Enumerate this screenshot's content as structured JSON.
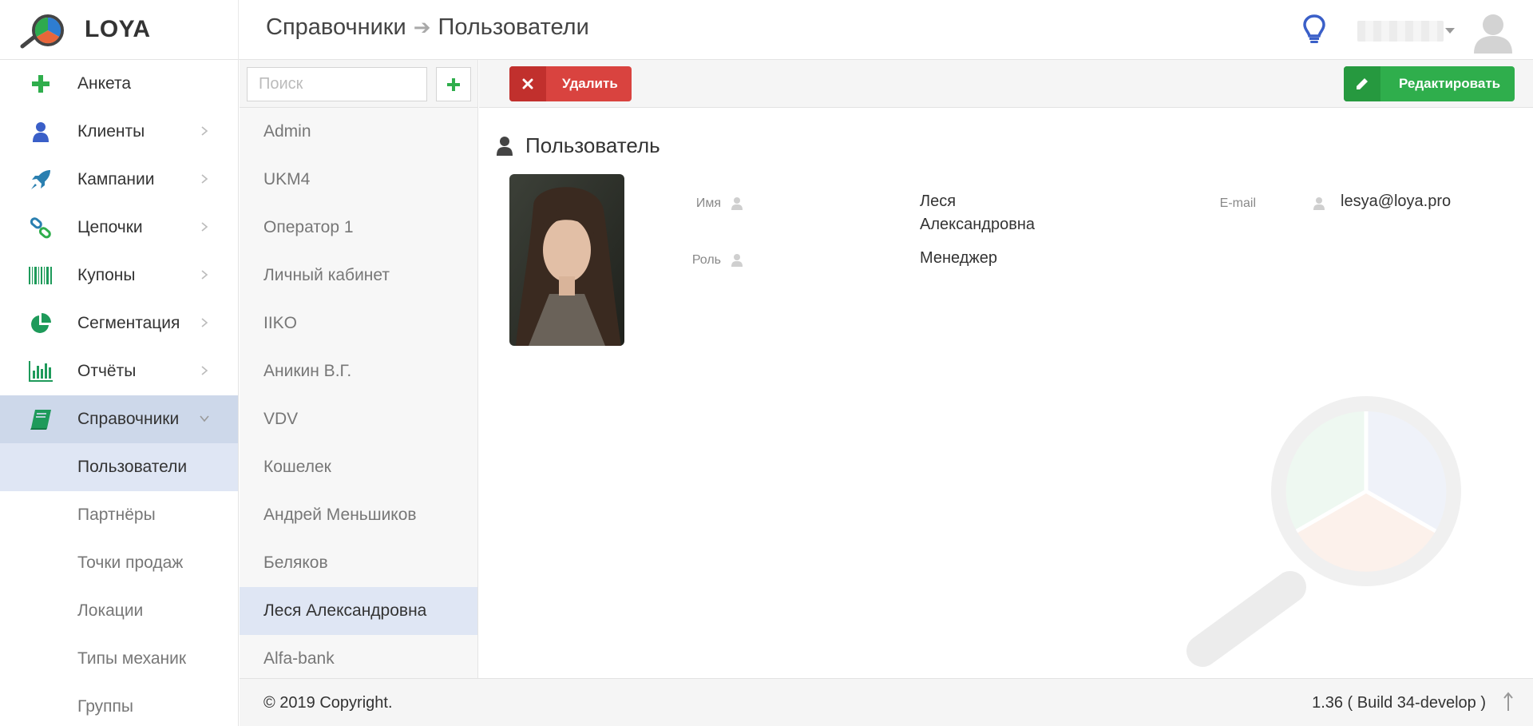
{
  "app": {
    "name": "LOYA"
  },
  "breadcrumb": {
    "parent": "Справочники",
    "sep": "➔",
    "current": "Пользователи"
  },
  "colors": {
    "accent_green": "#2fae4c",
    "danger_red": "#d9433f",
    "active_bg": "#cdd8ea",
    "icon_blue": "#3a5fc8",
    "icon_green": "#1e9a5a"
  },
  "sidebar": {
    "items": [
      {
        "label": "Анкета",
        "icon": "plus-icon"
      },
      {
        "label": "Клиенты",
        "icon": "user-icon"
      },
      {
        "label": "Кампании",
        "icon": "rocket-icon"
      },
      {
        "label": "Цепочки",
        "icon": "link-icon"
      },
      {
        "label": "Купоны",
        "icon": "barcode-icon"
      },
      {
        "label": "Сегментация",
        "icon": "pie-icon"
      },
      {
        "label": "Отчёты",
        "icon": "bar-chart-icon"
      },
      {
        "label": "Справочники",
        "icon": "book-icon"
      }
    ],
    "subitems": [
      {
        "label": "Пользователи"
      },
      {
        "label": "Партнёры"
      },
      {
        "label": "Точки продаж"
      },
      {
        "label": "Локации"
      },
      {
        "label": "Типы механик"
      },
      {
        "label": "Группы"
      }
    ]
  },
  "list": {
    "search_placeholder": "Поиск",
    "items": [
      "Admin",
      "UKM4",
      "Оператор 1",
      "Личный кабинет",
      "IIKO",
      "Аникин В.Г.",
      "VDV",
      "Кошелек",
      "Андрей Меньшиков",
      "Беляков",
      "Леся Александровна",
      "Alfa-bank"
    ]
  },
  "toolbar": {
    "delete_label": "Удалить",
    "edit_label": "Редактировать"
  },
  "user": {
    "section_title": "Пользователь",
    "name_label": "Имя",
    "name_line1": "Леся",
    "name_line2": "Александровна",
    "role_label": "Роль",
    "role_value": "Менеджер",
    "email_label": "E-mail",
    "email_value": "lesya@loya.pro"
  },
  "footer": {
    "copyright": "© 2019 Copyright.",
    "version": "1.36 ( Build 34-develop )"
  }
}
